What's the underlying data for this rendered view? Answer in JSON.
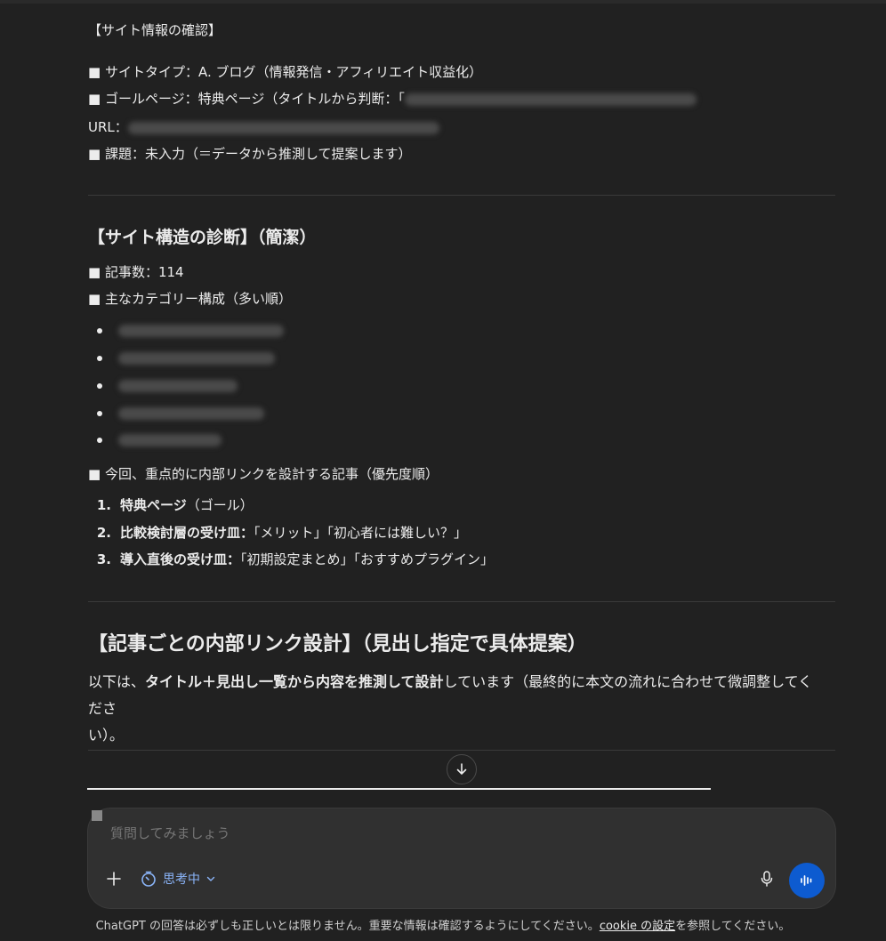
{
  "site_info": {
    "heading": "【サイト情報の確認】",
    "site_type": "■ サイトタイプ：A. ブログ（情報発信・アフィリエイト収益化）",
    "goal_page_prefix": "■ ゴールページ：特典ページ（タイトルから判断：「",
    "url_label": "URL：",
    "issue": "■ 課題：未入力（＝データから推測して提案します）"
  },
  "structure": {
    "heading": "【サイト構造の診断】（簡潔）",
    "article_count": "■ 記事数：114",
    "category_heading": "■ 主なカテゴリー構成（多い順）",
    "priority_heading": "■ 今回、重点的に内部リンクを設計する記事（優先度順）",
    "priority_items": [
      {
        "num": "1.",
        "bold": "特典ページ",
        "rest": "（ゴール）"
      },
      {
        "num": "2.",
        "bold": "比較検討層の受け皿：",
        "rest": "「メリット」「初心者には難しい？」"
      },
      {
        "num": "3.",
        "bold": "導入直後の受け皿：",
        "rest": "「初期設定まとめ」「おすすめプラグイン」"
      }
    ]
  },
  "design": {
    "heading": "【記事ごとの内部リンク設計】（見出し指定で具体提案）",
    "intro_1": "以下は、",
    "intro_bold_1": "タイトル＋見出し一覧から内容を推測して設計",
    "intro_2": "しています（最終的に本文の流れに合わせて微調整してくださ",
    "intro_3": "い）。"
  },
  "composer": {
    "placeholder": "質問してみましょう",
    "mode_label": "思考中"
  },
  "footer": {
    "text_before": "ChatGPT の回答は必ずしも正しいとは限りません。重要な情報は確認するようにしてください。",
    "link": "cookie の設定",
    "text_after": "を参照してください。"
  },
  "colors": {
    "background": "#212121",
    "composer": "#303030",
    "accent": "#0d5bd0",
    "mode_label": "#8ab4f8"
  }
}
